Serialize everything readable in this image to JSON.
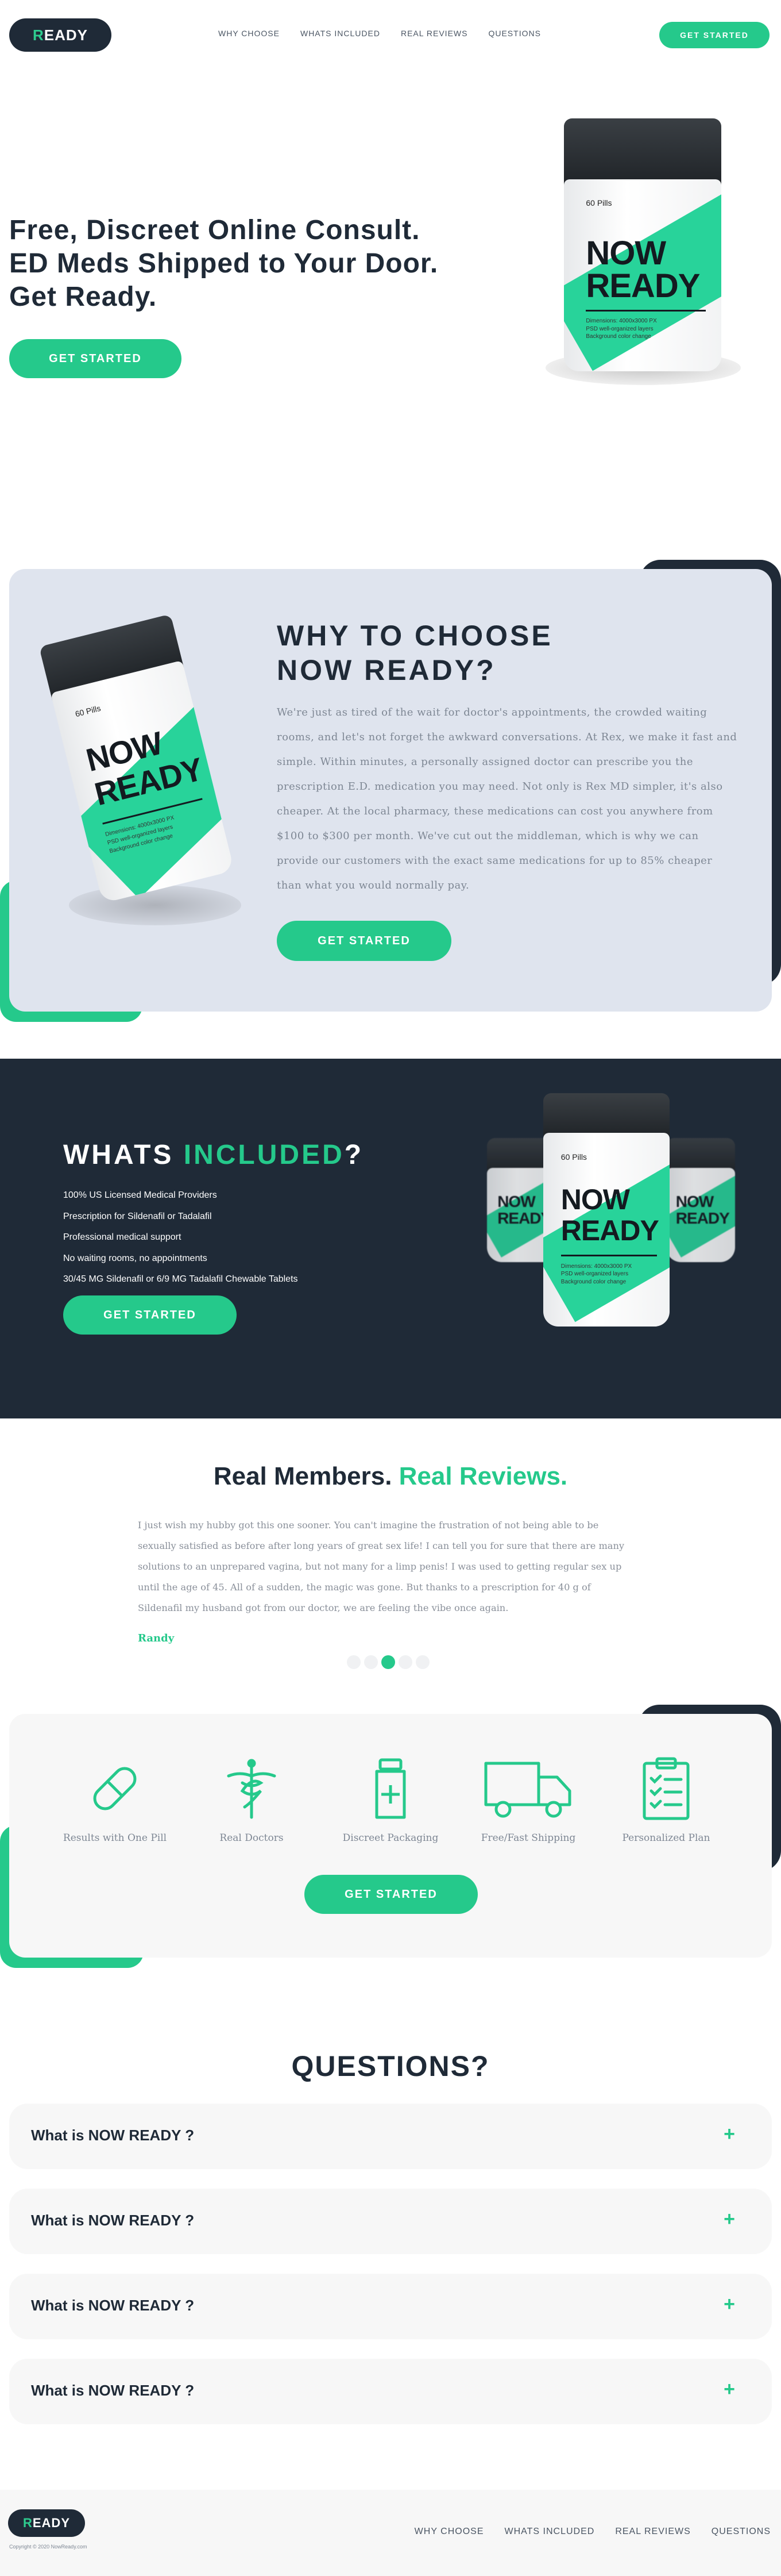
{
  "brand": {
    "logo_first": "R",
    "logo_rest": "EADY"
  },
  "nav": {
    "links": [
      "WHY CHOOSE",
      "WHATS INCLUDED",
      "REAL REVIEWS",
      "QUESTIONS"
    ],
    "cta": "GET STARTED"
  },
  "hero": {
    "lines": [
      "Free, Discreet Online Consult.",
      "ED Meds Shipped to Your Door.",
      "Get Ready."
    ],
    "cta": "GET STARTED"
  },
  "bottle": {
    "pills": "60 Pills",
    "word1": "NOW",
    "word2": "READY",
    "fine1": "Dimensions: 4000x3000 PX",
    "fine2": "PSD well-organized layers",
    "fine3": "Background color change"
  },
  "why": {
    "title1": "WHY TO CHOOSE",
    "title2": "NOW READY?",
    "text": "We're just as tired of the wait for doctor's appointments, the crowded waiting rooms, and let's not forget the awkward conversations. At Rex, we make it fast and simple. Within minutes, a personally assigned doctor can prescribe you the prescription E.D. medication you may need. Not only is Rex MD simpler, it's also cheaper. At the local pharmacy, these medications can cost you anywhere from $100 to $300 per month. We've cut out the middleman, which is why we can provide our customers with the exact same medications for up to 85% cheaper than what you would normally pay.",
    "cta": "GET STARTED"
  },
  "included": {
    "title_a": "WHATS ",
    "title_b": "INCLUDED",
    "title_c": "?",
    "items": [
      "100% US Licensed Medical Providers",
      "Prescription for Sildenafil or Tadalafil",
      "Professional medical support",
      "No waiting rooms, no appointments",
      "30/45 MG Sildenafil or 6/9 MG Tadalafil Chewable Tablets"
    ],
    "cta": "GET STARTED"
  },
  "reviews": {
    "title_a": "Real Members. ",
    "title_b": "Real Reviews.",
    "text": "I just wish my hubby got this one sooner. You can't imagine the frustration of not being able to be sexually satisfied as before after long years of great sex life! I can tell you for sure that there are many solutions to an unprepared vagina, but not many for a limp penis! I was used to getting regular sex up until the age of 45. All of a sudden, the magic was gone. But thanks to a prescription for 40 g of Sildenafil my husband got from our doctor, we are feeling the vibe once again.",
    "name": "Randy",
    "slide_count": 5,
    "active_slide": 3
  },
  "features": {
    "items": [
      "Results with One Pill",
      "Real Doctors",
      "Discreet Packaging",
      "Free/Fast Shipping",
      "Personalized Plan"
    ],
    "icons": [
      "pill-icon",
      "caduceus-icon",
      "medicine-bottle-icon",
      "truck-icon",
      "clipboard-icon"
    ],
    "cta": "GET STARTED"
  },
  "questions": {
    "title": "QUESTIONS?",
    "items": [
      "What is NOW READY ?",
      "What is NOW READY ?",
      "What is NOW READY ?",
      "What is NOW READY ?"
    ],
    "toggle": "+"
  },
  "footer": {
    "copyright": "Copyright © 2020 NowReady.com",
    "links": [
      "WHY CHOOSE",
      "WHATS INCLUDED",
      "REAL REVIEWS",
      "QUESTIONS"
    ]
  },
  "colors": {
    "accent": "#25c98b",
    "dark": "#1f2a37",
    "panel": "#dfe4ee",
    "light": "#f7f7f7"
  }
}
